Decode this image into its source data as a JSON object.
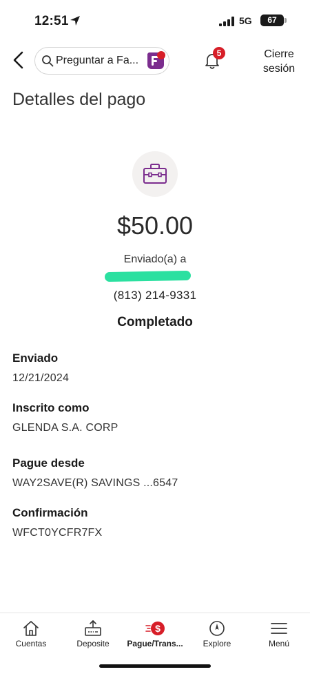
{
  "status_bar": {
    "time": "12:51",
    "network": "5G",
    "battery": "67"
  },
  "header": {
    "search_placeholder": "Preguntar a Fa...",
    "notification_count": "5",
    "logout_line1": "Cierre",
    "logout_line2": "sesión"
  },
  "page": {
    "title": "Detalles del pago"
  },
  "payment": {
    "amount": "$50.00",
    "sent_to_label": "Enviado(a) a",
    "phone": "(813) 214-9331",
    "status": "Completado"
  },
  "details": [
    {
      "label": "Enviado",
      "value": "12/21/2024"
    },
    {
      "label": "Inscrito como",
      "value": "GLENDA S.A. CORP"
    },
    {
      "label": "Pague desde",
      "value": "WAY2SAVE(R) SAVINGS ...6547"
    },
    {
      "label": "Confirmación",
      "value": "WFCT0YCFR7FX"
    }
  ],
  "nav": {
    "items": [
      {
        "label": "Cuentas",
        "icon": "home-icon"
      },
      {
        "label": "Deposite",
        "icon": "deposit-icon"
      },
      {
        "label": "Pague/Trans...",
        "icon": "pay-transfer-icon",
        "active": true
      },
      {
        "label": "Explore",
        "icon": "compass-icon"
      },
      {
        "label": "Menú",
        "icon": "menu-icon"
      }
    ]
  },
  "colors": {
    "brand_red": "#d71e28",
    "brand_purple": "#7b2d8e",
    "redaction_green": "#2be0a0"
  }
}
